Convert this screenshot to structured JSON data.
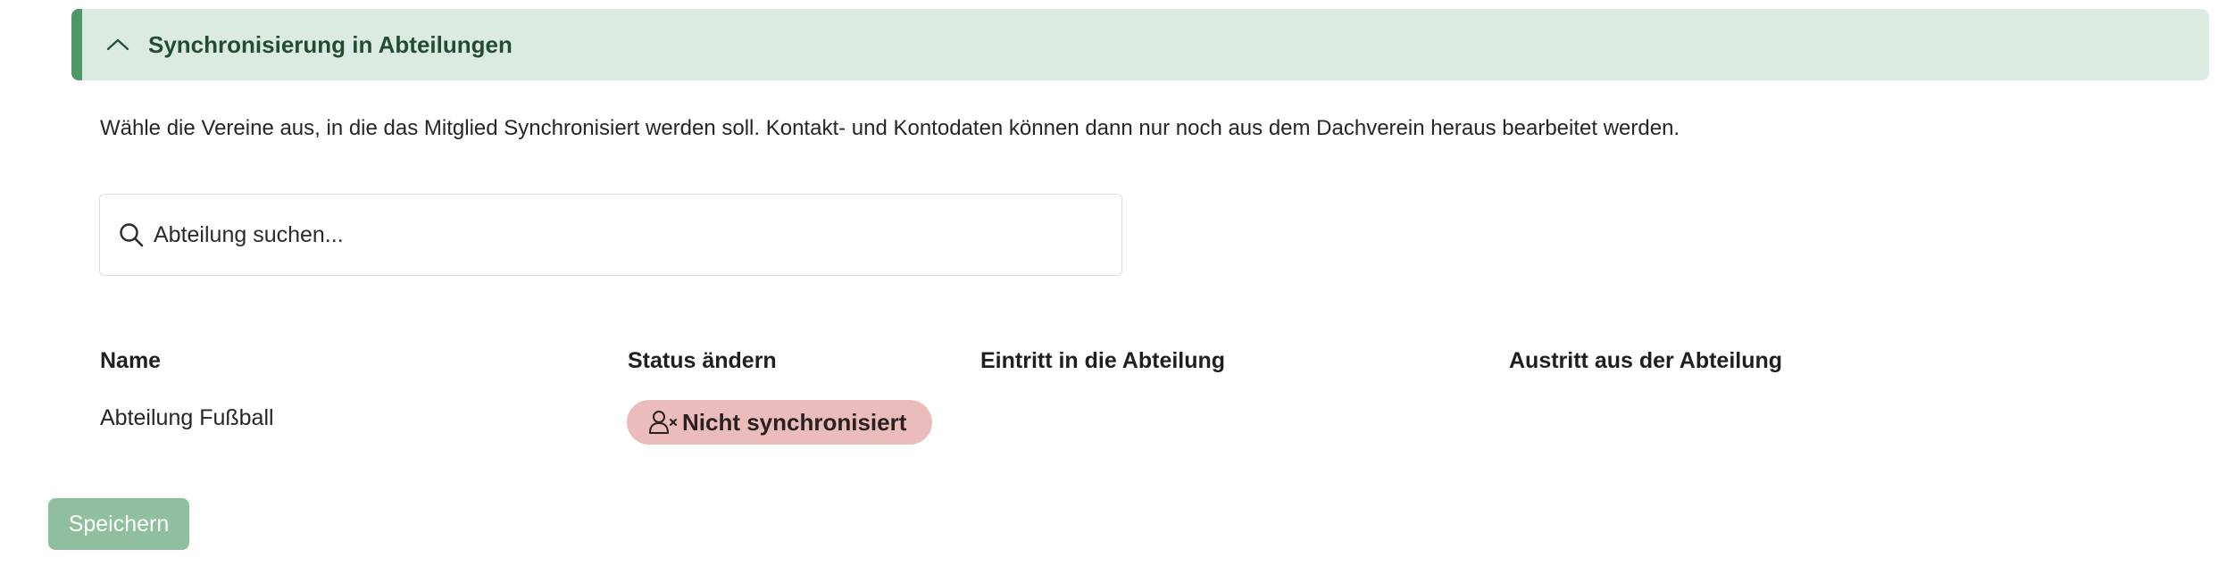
{
  "section": {
    "title": "Synchronisierung in Abteilungen",
    "expanded_icon": "chevron-up-icon",
    "accent_color": "#4f9766",
    "background_color": "#dcebe1"
  },
  "description": "Wähle die Vereine aus, in die das Mitglied Synchronisiert werden soll. Kontakt- und Kontodaten können dann nur noch aus dem Dachverein heraus bearbeitet werden.",
  "search": {
    "icon": "search-icon",
    "placeholder": "Abteilung suchen...",
    "value": ""
  },
  "table": {
    "columns": [
      "Name",
      "Status ändern",
      "Eintritt in die Abteilung",
      "Austritt aus der Abteilung"
    ],
    "rows": [
      {
        "name": "Abteilung Fußball",
        "status": {
          "label": "Nicht synchronisiert",
          "icon": "user-x-icon",
          "color": "#ebbcbc"
        },
        "eintritt": "",
        "austritt": ""
      }
    ]
  },
  "actions": {
    "save_label": "Speichern",
    "save_color": "#8fbf9e"
  }
}
